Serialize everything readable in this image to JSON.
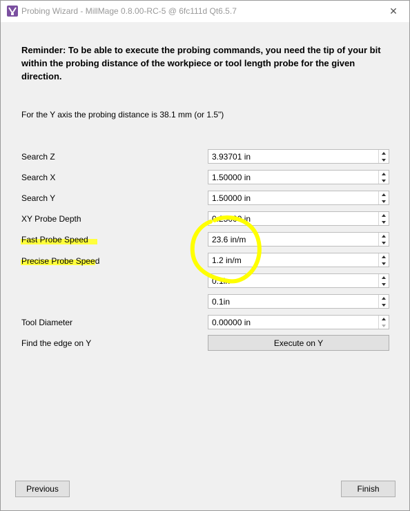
{
  "window": {
    "title": "Probing Wizard - MillMage 0.8.00-RC-5 @ 6fc111d Qt6.5.7",
    "close_icon": "close-icon"
  },
  "reminder": "Reminder: To be able to execute the probing commands, you need the tip of your bit within the probing distance of the workpiece or tool length probe for the given direction.",
  "info": "For the Y axis the probing distance is 38.1 mm (or 1.5\")",
  "fields": {
    "search_z": {
      "label": "Search Z",
      "value": "3.93701 in"
    },
    "search_x": {
      "label": "Search X",
      "value": "1.50000 in"
    },
    "search_y": {
      "label": "Search Y",
      "value": "1.50000 in"
    },
    "xy_probe_depth": {
      "label": "XY Probe Depth",
      "value": "0.25000 in"
    },
    "fast_probe_speed": {
      "label": "Fast Probe Speed",
      "value": "23.6 in/m"
    },
    "precise_probe_speed": {
      "label": "Precise Probe Speed",
      "value": "1.2 in/m"
    },
    "unlabeled_1": {
      "value": "0.1in"
    },
    "unlabeled_2": {
      "value": "0.1in"
    },
    "tool_diameter": {
      "label": "Tool Diameter",
      "value": "0.00000 in"
    }
  },
  "edge": {
    "label": "Find the edge on Y",
    "button": "Execute on Y"
  },
  "footer": {
    "previous": "Previous",
    "finish": "Finish"
  },
  "annotations": {
    "highlight_color": "#ffff3c",
    "circle_color": "#ffff00"
  }
}
